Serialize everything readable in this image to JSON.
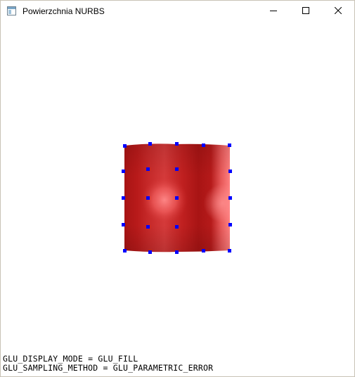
{
  "window": {
    "title": "Powierzchnia NURBS",
    "icon": "app-window-icon",
    "controls": {
      "minimize_icon": "minimize-icon",
      "maximize_icon": "maximize-icon",
      "close_icon": "close-icon"
    }
  },
  "scene": {
    "surface_type": "NURBS surface",
    "surface_color": "#b01818",
    "highlight_color": "#ff7a7a",
    "control_point_color": "#0000ff",
    "control_points_grid": "4x4"
  },
  "status": {
    "display_mode_line": "GLU_DISPLAY_MODE = GLU_FILL",
    "sampling_method_line": "GLU_SAMPLING_METHOD = GLU_PARAMETRIC_ERROR"
  }
}
